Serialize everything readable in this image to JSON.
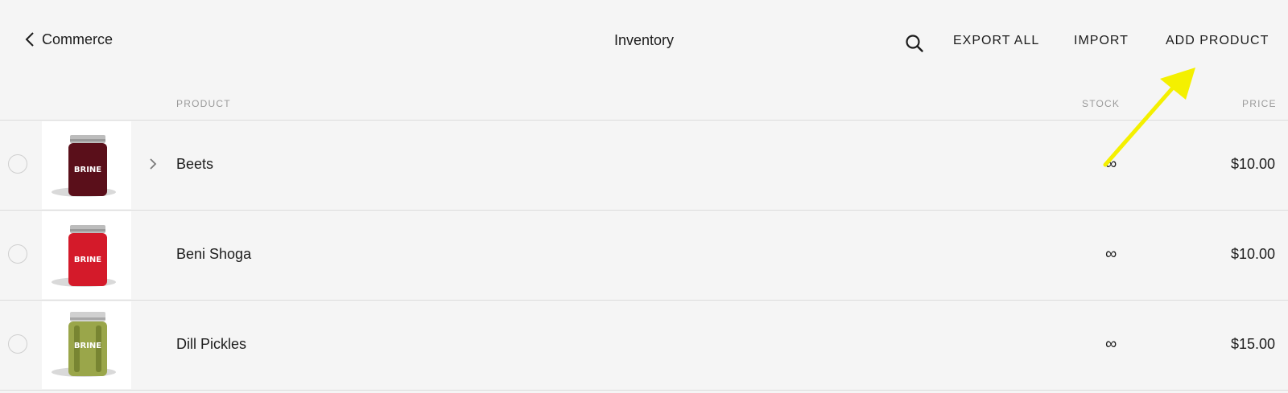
{
  "header": {
    "back_label": "Commerce",
    "title": "Inventory",
    "export_all_label": "EXPORT ALL",
    "import_label": "IMPORT",
    "add_product_label": "ADD PRODUCT"
  },
  "columns": {
    "product": "PRODUCT",
    "stock": "STOCK",
    "price": "PRICE"
  },
  "products": [
    {
      "name": "Beets",
      "stock": "∞",
      "price": "$10.00",
      "jar_color": "#5a0f1a",
      "jar_label": "BRINE",
      "expandable": true
    },
    {
      "name": "Beni Shoga",
      "stock": "∞",
      "price": "$10.00",
      "jar_color": "#d41a2a",
      "jar_label": "BRINE",
      "expandable": false
    },
    {
      "name": "Dill Pickles",
      "stock": "∞",
      "price": "$15.00",
      "jar_color": "#9aa64a",
      "jar_label": "BRINE",
      "expandable": false
    }
  ],
  "annotation": {
    "arrow_color": "#f4f000"
  }
}
